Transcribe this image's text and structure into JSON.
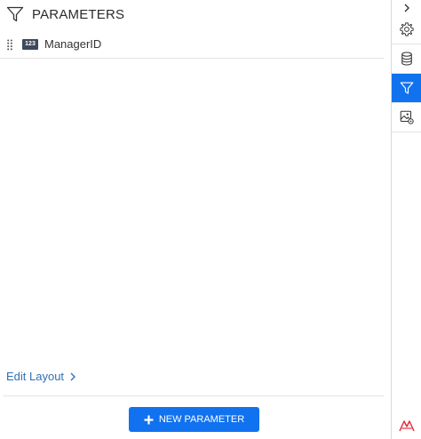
{
  "panel": {
    "title": "PARAMETERS",
    "parameters": [
      {
        "type_badge": "123",
        "name": "ManagerID"
      }
    ],
    "edit_layout_label": "Edit Layout",
    "new_parameter_label": "NEW PARAMETER"
  },
  "rail": {
    "items": [
      {
        "icon": "gear-icon",
        "active": false
      },
      {
        "icon": "database-icon",
        "active": false
      },
      {
        "icon": "filter-icon",
        "active": true
      },
      {
        "icon": "image-settings-icon",
        "active": false
      }
    ]
  },
  "colors": {
    "accent": "#1172f0",
    "link": "#2f6fb4",
    "badge": "#3d4a5c",
    "logo": "#e0303e"
  }
}
